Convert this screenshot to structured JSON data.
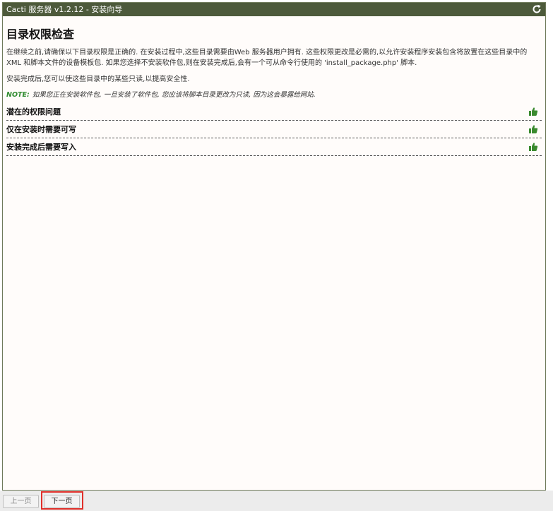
{
  "window": {
    "title": "Cacti 服务器 v1.2.12 - 安装向导",
    "refresh_icon": "refresh-icon"
  },
  "main": {
    "page_title": "目录权限检查",
    "para1": "在继续之前,请确保以下目录权限是正确的. 在安装过程中,这些目录需要由Web 服务器用户拥有. 这些权限更改是必需的,以允许安装程序安装包含将放置在这些目录中的XML 和脚本文件的设备模板包. 如果您选择不安装软件包,则在安装完成后,会有一个可从命令行使用的 'install_package.php' 脚本.",
    "para2": "安装完成后,您可以使这些目录中的某些只读,以提高安全性.",
    "note_label": "NOTE:",
    "note_text": "如果您正在安装软件包, 一旦安装了软件包, 您应该将脚本目录更改为只读, 因为这会暴露给网站.",
    "sections": [
      {
        "title": "潜在的权限问题",
        "status_icon": "thumbs-up-icon"
      },
      {
        "title": "仅在安装时需要可写",
        "status_icon": "thumbs-up-icon"
      },
      {
        "title": "安装完成后需要写入",
        "status_icon": "thumbs-up-icon"
      }
    ],
    "status_color": "#3a8a2e"
  },
  "footer": {
    "prev_label": "上一页",
    "next_label": "下一页",
    "highlight_color": "#e0302a"
  }
}
